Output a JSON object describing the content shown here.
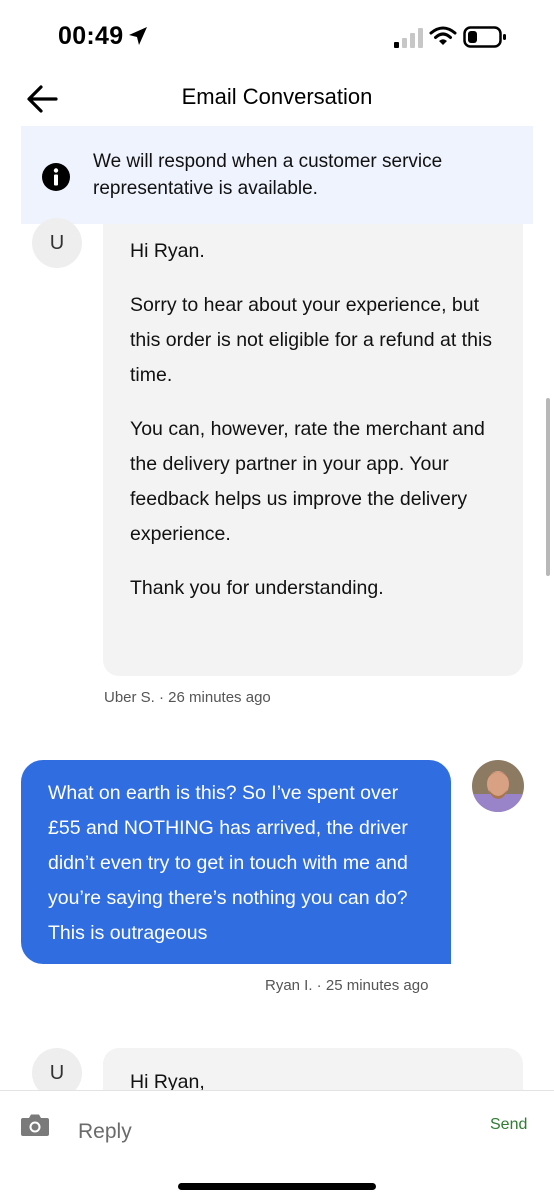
{
  "status_bar": {
    "time": "00:49"
  },
  "header": {
    "title": "Email Conversation"
  },
  "banner": {
    "text": "We will respond when a customer service representative is available."
  },
  "messages": [
    {
      "avatar_initial": "U",
      "paragraphs": [
        "Hi Ryan.",
        "Sorry to hear about your experience, but this order is not eligible for a refund at this time.",
        "You can, however, rate the merchant and the delivery partner in your app. Your feedback helps us improve the delivery experience.",
        "Thank you for understanding."
      ],
      "meta": "Uber S. · 26 minutes ago"
    },
    {
      "text": "What on earth is this? So I’ve spent over £55 and NOTHING has arrived, the driver didn’t even try to get in touch with me and you’re saying there’s nothing you can do? This is outrageous",
      "meta": "Ryan I. · 25 minutes ago"
    },
    {
      "avatar_initial": "U",
      "paragraphs": [
        "Hi Ryan,"
      ]
    }
  ],
  "reply": {
    "placeholder": "Reply",
    "send_label": "Send"
  },
  "colors": {
    "user_bubble": "#2f6de1",
    "agent_bubble": "#f3f3f3",
    "banner_bg": "#eef3fd",
    "send": "#2e7d32"
  },
  "icons": [
    "location-arrow-icon",
    "cellular-signal-icon",
    "wifi-icon",
    "battery-icon",
    "back-arrow-icon",
    "info-icon",
    "camera-icon"
  ]
}
